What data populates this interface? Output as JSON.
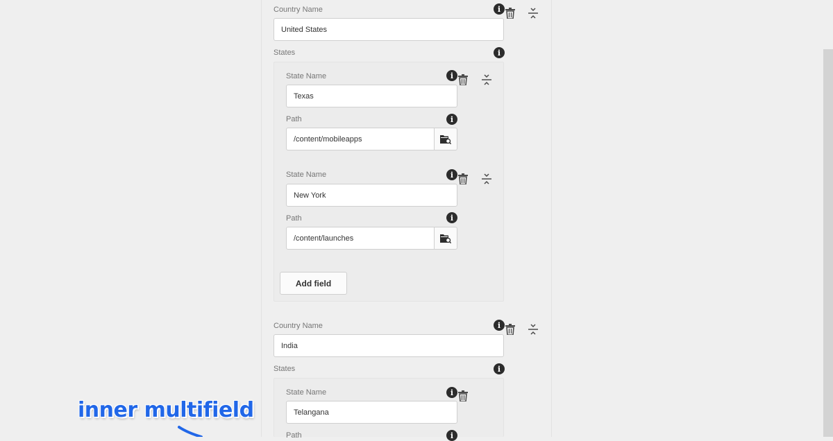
{
  "colors": {
    "page_background": "#efefef",
    "field_background": "#ffffff",
    "info_icon": "#2c2c2c",
    "callout_text": "#2167e8"
  },
  "countries": [
    {
      "name_label": "Country Name",
      "name_value": "United States",
      "states_label": "States",
      "states": [
        {
          "name_label": "State Name",
          "name_value": "Texas",
          "path_label": "Path",
          "path_value": "/content/mobileapps"
        },
        {
          "name_label": "State Name",
          "name_value": "New York",
          "path_label": "Path",
          "path_value": "/content/launches"
        }
      ],
      "add_field_label": "Add field"
    },
    {
      "name_label": "Country Name",
      "name_value": "India",
      "states_label": "States",
      "states": [
        {
          "name_label": "State Name",
          "name_value": "Telangana",
          "path_label": "Path"
        }
      ]
    }
  ],
  "icons": {
    "info": "info-icon",
    "delete": "trash-icon",
    "reorder": "reorder-icon",
    "browse": "folder-search-icon"
  },
  "annotation": {
    "callout_text": "inner multifield"
  }
}
